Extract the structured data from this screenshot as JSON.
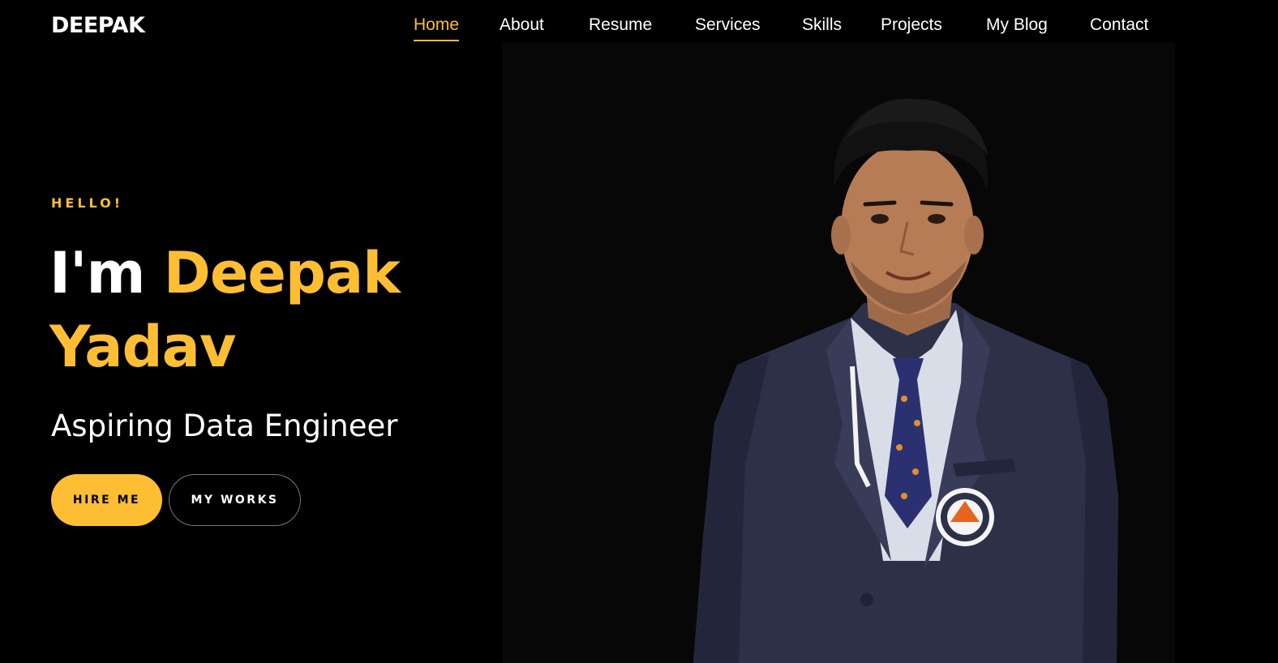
{
  "header": {
    "logo": "DEEPAK",
    "nav": [
      {
        "label": "Home",
        "active": true
      },
      {
        "label": "About"
      },
      {
        "label": "Resume"
      },
      {
        "label": "Services"
      },
      {
        "label": "Skills"
      },
      {
        "label": "Projects"
      },
      {
        "label": "My Blog"
      },
      {
        "label": "Contact"
      }
    ]
  },
  "hero": {
    "greeting": "HELLO!",
    "intro": "I'm",
    "first_name": "Deepak",
    "last_name": "Yadav",
    "role": "Aspiring Data Engineer",
    "primary_button": "HIRE ME",
    "secondary_button": "MY WORKS",
    "photo_alt": "portrait-photo"
  },
  "colors": {
    "accent": "#fdbe34",
    "background": "#000000",
    "panel": "#070707",
    "text": "#ffffff"
  }
}
